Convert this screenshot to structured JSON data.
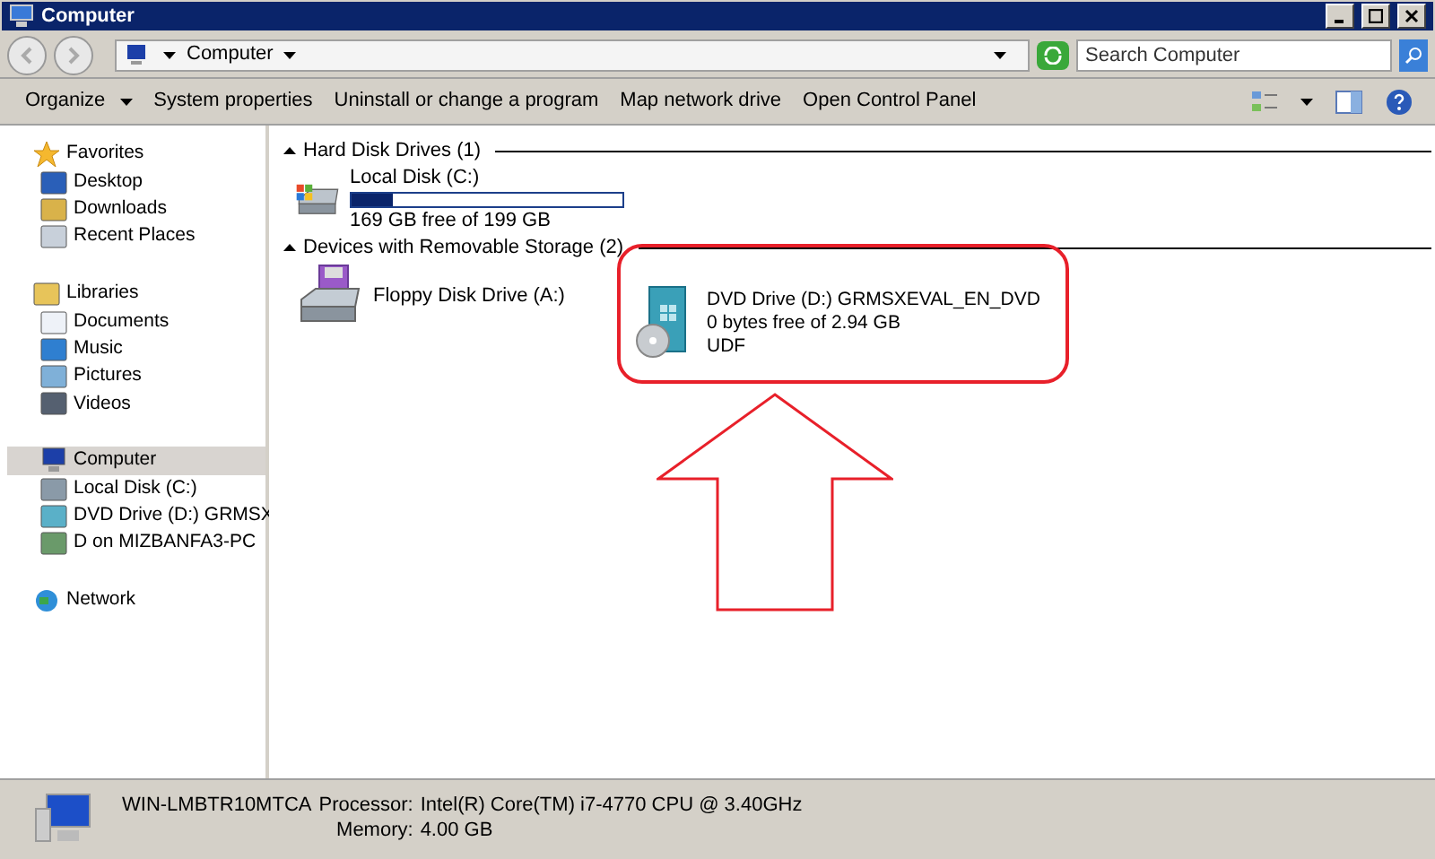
{
  "window": {
    "title": "Computer"
  },
  "address": {
    "crumbs": [
      "Computer"
    ]
  },
  "search": {
    "placeholder": "Search Computer"
  },
  "toolbar": [
    {
      "label": "Organize",
      "dropdown": true
    },
    {
      "label": "System properties",
      "dropdown": false
    },
    {
      "label": "Uninstall or change a program",
      "dropdown": false
    },
    {
      "label": "Map network drive",
      "dropdown": false
    },
    {
      "label": "Open Control Panel",
      "dropdown": false
    }
  ],
  "sidebar": [
    {
      "label": "Favorites",
      "selected": false,
      "children": [
        {
          "label": "Desktop",
          "selected": false
        },
        {
          "label": "Downloads",
          "selected": false
        },
        {
          "label": "Recent Places",
          "selected": false
        }
      ]
    },
    {
      "label": "Libraries",
      "selected": false,
      "children": [
        {
          "label": "Documents",
          "selected": false
        },
        {
          "label": "Music",
          "selected": false
        },
        {
          "label": "Pictures",
          "selected": false
        },
        {
          "label": "Videos",
          "selected": false
        }
      ]
    },
    {
      "label": "Computer",
      "selected": true,
      "children": [
        {
          "label": "Local Disk (C:)",
          "selected": false
        },
        {
          "label": "DVD Drive (D:) GRMSX",
          "selected": false
        },
        {
          "label": "D on MIZBANFA3-PC",
          "selected": false
        }
      ]
    },
    {
      "label": "Network",
      "selected": false
    }
  ],
  "sections": [
    {
      "title": "Hard Disk Drives (1)",
      "items": [
        {
          "kind": "disk",
          "name": "Local Disk (C:)",
          "level": 0.15,
          "lines": [
            "169 GB free of 199 GB"
          ]
        }
      ]
    },
    {
      "title": "Devices with Removable Storage (2)",
      "items": [
        {
          "kind": "floppy",
          "name": "Floppy Disk Drive (A:)"
        },
        {
          "kind": "dvd",
          "name": "DVD Drive (D:) GRMSXEVAL_EN_DVD",
          "lines": [
            "0 bytes free of 2.94 GB",
            "UDF"
          ]
        }
      ]
    }
  ],
  "details": {
    "name": "WIN-LMBTR10MTCA",
    "fields": [
      {
        "label": "Processor:",
        "value": "Intel(R) Core(TM) i7-4770 CPU @ 3.40GHz"
      },
      {
        "label": "Memory:",
        "value": "4.00 GB"
      }
    ]
  }
}
